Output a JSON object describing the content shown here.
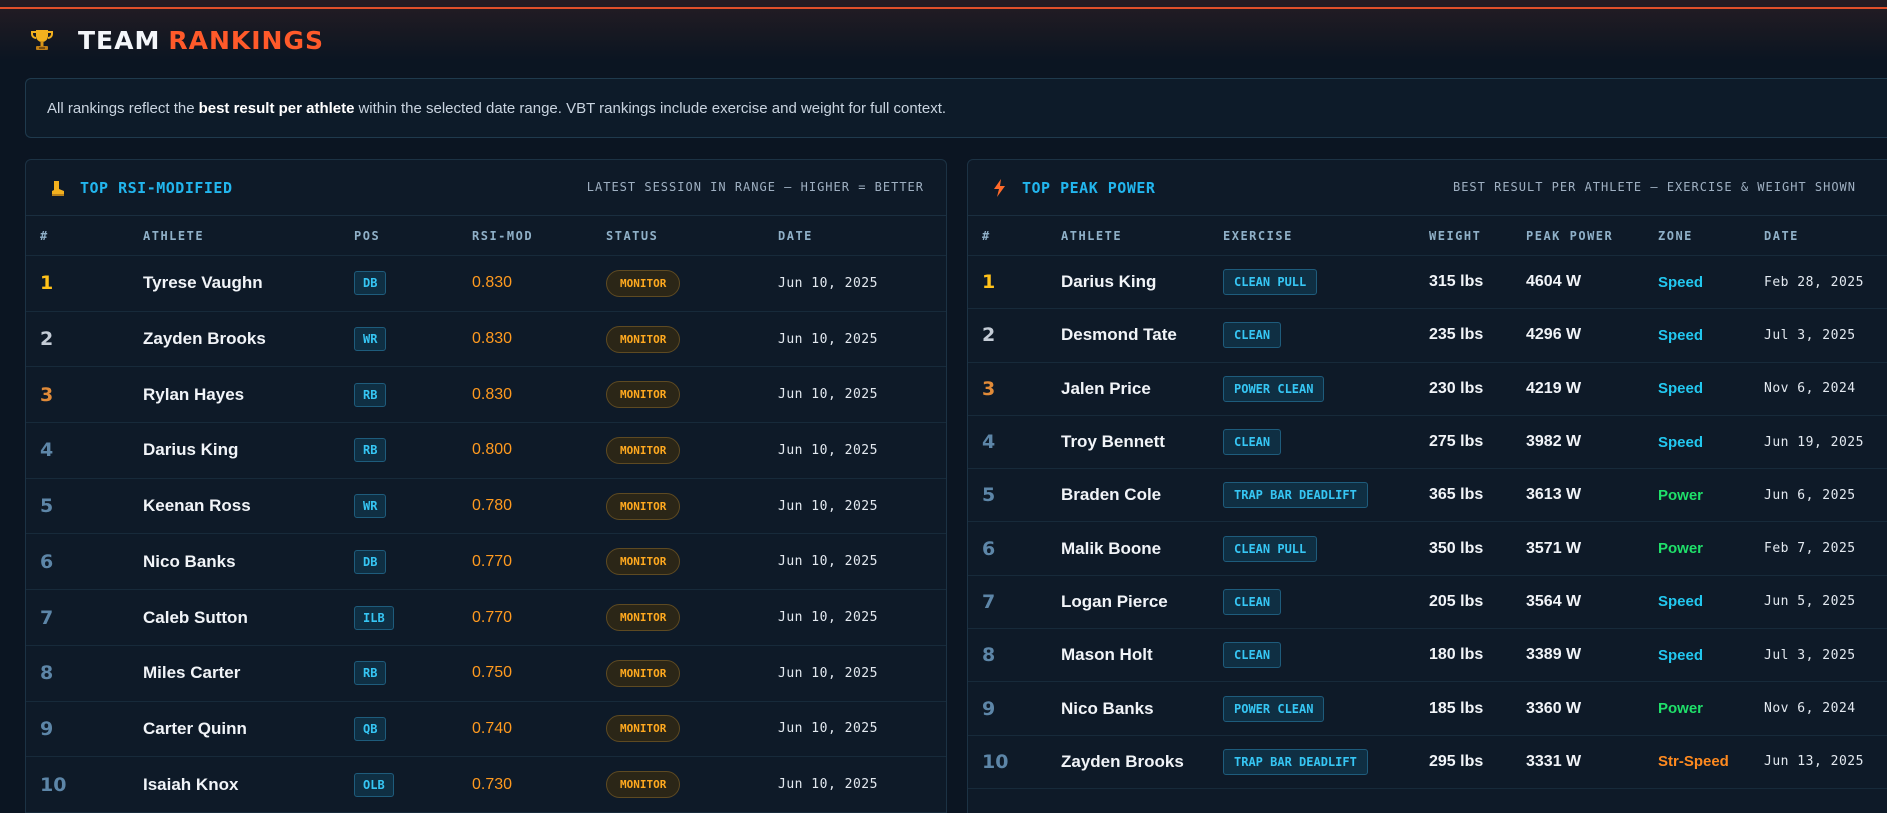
{
  "header": {
    "title_white": "TEAM",
    "title_orange": "RANKINGS",
    "icon": "trophy-icon"
  },
  "info": {
    "before": "All rankings reflect the",
    "bold": "best result per athlete",
    "after": "within the selected date range. VBT rankings include exercise and weight for full context."
  },
  "rsi_panel": {
    "title": "TOP RSI-MODIFIED",
    "subtitle": "LATEST SESSION IN RANGE — HIGHER = BETTER",
    "icon": "boot-icon",
    "columns": [
      "#",
      "ATHLETE",
      "POS",
      "RSI-MOD",
      "STATUS",
      "DATE"
    ],
    "rows": [
      {
        "rank": "1",
        "athlete": "Tyrese Vaughn",
        "pos": "DB",
        "rsi": "0.830",
        "status": "MONITOR",
        "date": "Jun 10, 2025"
      },
      {
        "rank": "2",
        "athlete": "Zayden Brooks",
        "pos": "WR",
        "rsi": "0.830",
        "status": "MONITOR",
        "date": "Jun 10, 2025"
      },
      {
        "rank": "3",
        "athlete": "Rylan Hayes",
        "pos": "RB",
        "rsi": "0.830",
        "status": "MONITOR",
        "date": "Jun 10, 2025"
      },
      {
        "rank": "4",
        "athlete": "Darius King",
        "pos": "RB",
        "rsi": "0.800",
        "status": "MONITOR",
        "date": "Jun 10, 2025"
      },
      {
        "rank": "5",
        "athlete": "Keenan Ross",
        "pos": "WR",
        "rsi": "0.780",
        "status": "MONITOR",
        "date": "Jun 10, 2025"
      },
      {
        "rank": "6",
        "athlete": "Nico Banks",
        "pos": "DB",
        "rsi": "0.770",
        "status": "MONITOR",
        "date": "Jun 10, 2025"
      },
      {
        "rank": "7",
        "athlete": "Caleb Sutton",
        "pos": "ILB",
        "rsi": "0.770",
        "status": "MONITOR",
        "date": "Jun 10, 2025"
      },
      {
        "rank": "8",
        "athlete": "Miles Carter",
        "pos": "RB",
        "rsi": "0.750",
        "status": "MONITOR",
        "date": "Jun 10, 2025"
      },
      {
        "rank": "9",
        "athlete": "Carter Quinn",
        "pos": "QB",
        "rsi": "0.740",
        "status": "MONITOR",
        "date": "Jun 10, 2025"
      },
      {
        "rank": "10",
        "athlete": "Isaiah Knox",
        "pos": "OLB",
        "rsi": "0.730",
        "status": "MONITOR",
        "date": "Jun 10, 2025"
      }
    ]
  },
  "power_panel": {
    "title": "TOP PEAK POWER",
    "subtitle": "BEST RESULT PER ATHLETE — EXERCISE & WEIGHT SHOWN",
    "icon": "lightning-icon",
    "columns": [
      "#",
      "ATHLETE",
      "EXERCISE",
      "WEIGHT",
      "PEAK POWER",
      "ZONE",
      "DATE"
    ],
    "rows": [
      {
        "rank": "1",
        "athlete": "Darius King",
        "exercise": "CLEAN PULL",
        "weight": "315 lbs",
        "power": "4604 W",
        "zone": "Speed",
        "date": "Feb 28, 2025"
      },
      {
        "rank": "2",
        "athlete": "Desmond Tate",
        "exercise": "CLEAN",
        "weight": "235 lbs",
        "power": "4296 W",
        "zone": "Speed",
        "date": "Jul 3, 2025"
      },
      {
        "rank": "3",
        "athlete": "Jalen Price",
        "exercise": "POWER CLEAN",
        "weight": "230 lbs",
        "power": "4219 W",
        "zone": "Speed",
        "date": "Nov 6, 2024"
      },
      {
        "rank": "4",
        "athlete": "Troy Bennett",
        "exercise": "CLEAN",
        "weight": "275 lbs",
        "power": "3982 W",
        "zone": "Speed",
        "date": "Jun 19, 2025"
      },
      {
        "rank": "5",
        "athlete": "Braden Cole",
        "exercise": "TRAP BAR DEADLIFT",
        "weight": "365 lbs",
        "power": "3613 W",
        "zone": "Power",
        "date": "Jun 6, 2025"
      },
      {
        "rank": "6",
        "athlete": "Malik Boone",
        "exercise": "CLEAN PULL",
        "weight": "350 lbs",
        "power": "3571 W",
        "zone": "Power",
        "date": "Feb 7, 2025"
      },
      {
        "rank": "7",
        "athlete": "Logan Pierce",
        "exercise": "CLEAN",
        "weight": "205 lbs",
        "power": "3564 W",
        "zone": "Speed",
        "date": "Jun 5, 2025"
      },
      {
        "rank": "8",
        "athlete": "Mason Holt",
        "exercise": "CLEAN",
        "weight": "180 lbs",
        "power": "3389 W",
        "zone": "Speed",
        "date": "Jul 3, 2025"
      },
      {
        "rank": "9",
        "athlete": "Nico Banks",
        "exercise": "POWER CLEAN",
        "weight": "185 lbs",
        "power": "3360 W",
        "zone": "Power",
        "date": "Nov 6, 2024"
      },
      {
        "rank": "10",
        "athlete": "Zayden Brooks",
        "exercise": "TRAP BAR DEADLIFT",
        "weight": "295 lbs",
        "power": "3331 W",
        "zone": "Str-Speed",
        "date": "Jun 13, 2025"
      }
    ]
  },
  "colors": {
    "accent_orange": "#ff5a2a",
    "accent_cyan": "#22b6ee",
    "rank_gold": "#ffc21a",
    "rank_silver": "#c4ccd6",
    "rank_bronze": "#e08a38",
    "zone_speed": "#22c8f0",
    "zone_power": "#1fe06a",
    "zone_str_speed": "#ff8a1f"
  }
}
